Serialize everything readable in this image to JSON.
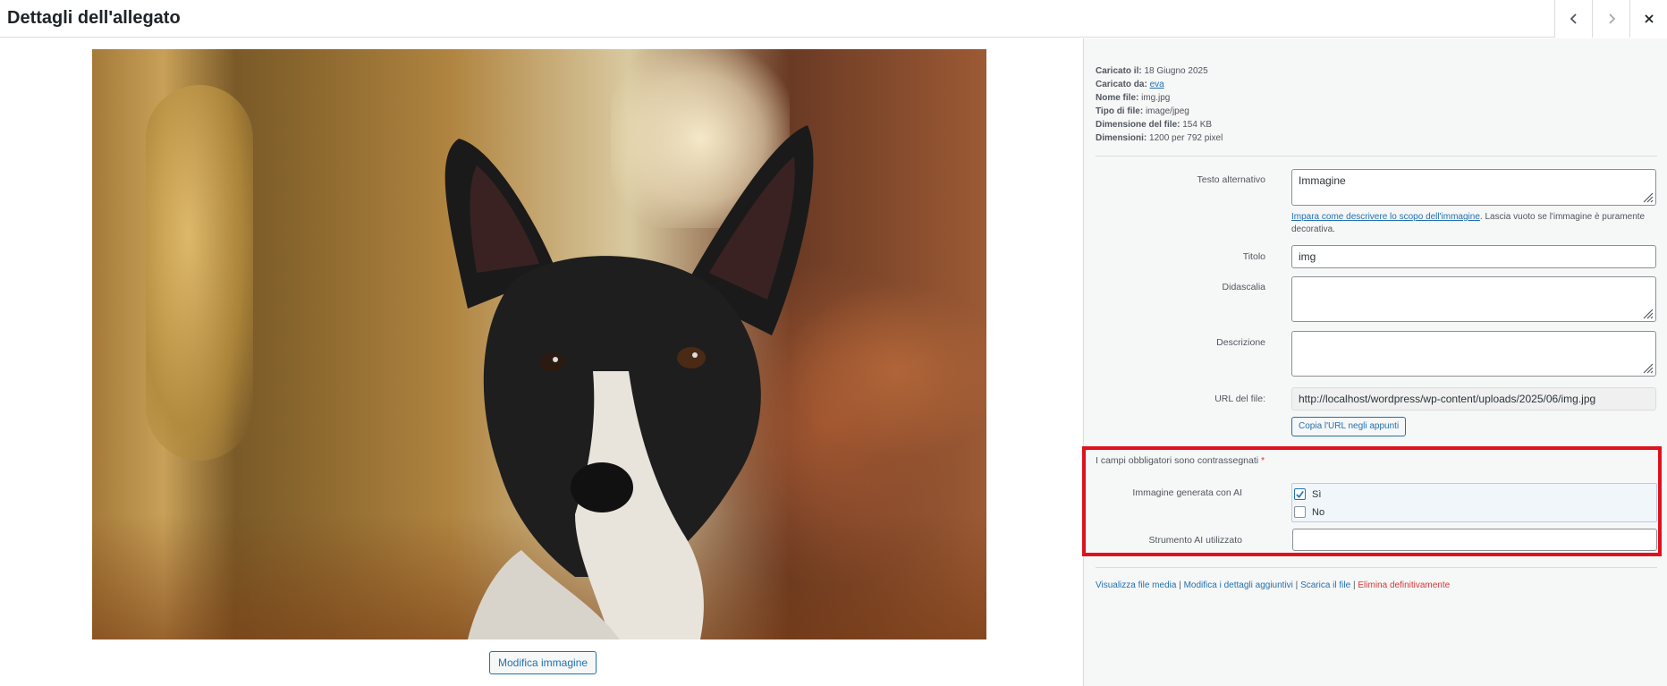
{
  "header": {
    "title": "Dettagli dell'allegato",
    "prev_icon": "chevron-left-icon",
    "next_icon": "chevron-right-icon",
    "close_icon": "close-icon"
  },
  "media": {
    "edit_button": "Modifica immagine"
  },
  "meta": {
    "uploaded_on_label": "Caricato il:",
    "uploaded_on_value": "18 Giugno 2025",
    "uploaded_by_label": "Caricato da:",
    "uploaded_by_value": "eva",
    "file_name_label": "Nome file:",
    "file_name_value": "img.jpg",
    "file_type_label": "Tipo di file:",
    "file_type_value": "image/jpeg",
    "file_size_label": "Dimensione del file:",
    "file_size_value": "154 KB",
    "dimensions_label": "Dimensioni:",
    "dimensions_value": "1200 per 792 pixel"
  },
  "form": {
    "alt_label": "Testo alternativo",
    "alt_value": "Immagine",
    "alt_help_link": "Impara come descrivere lo scopo dell'immagine",
    "alt_help_text": ". Lascia vuoto se l'immagine è puramente decorativa.",
    "title_label": "Titolo",
    "title_value": "img",
    "caption_label": "Didascalia",
    "caption_value": "",
    "description_label": "Descrizione",
    "description_value": "",
    "url_label": "URL del file:",
    "url_value": "http://localhost/wordpress/wp-content/uploads/2025/06/img.jpg",
    "copy_url_button": "Copia l'URL negli appunti"
  },
  "custom_fields": {
    "required_note": "I campi obbligatori sono contrassegnati",
    "required_star": "*",
    "ai_generated_label": "Immagine generata con AI",
    "options": [
      {
        "label": "Sì",
        "checked": true
      },
      {
        "label": "No",
        "checked": false
      }
    ],
    "ai_tool_label": "Strumento AI utilizzato",
    "ai_tool_value": ""
  },
  "actions": {
    "view_file": "Visualizza file media",
    "edit_details": "Modifica i dettagli aggiuntivi",
    "download": "Scarica il file",
    "delete": "Elimina definitivamente",
    "separator": "|"
  },
  "colors": {
    "link": "#2271b1",
    "danger": "#d63638",
    "highlight": "#e0101c"
  }
}
